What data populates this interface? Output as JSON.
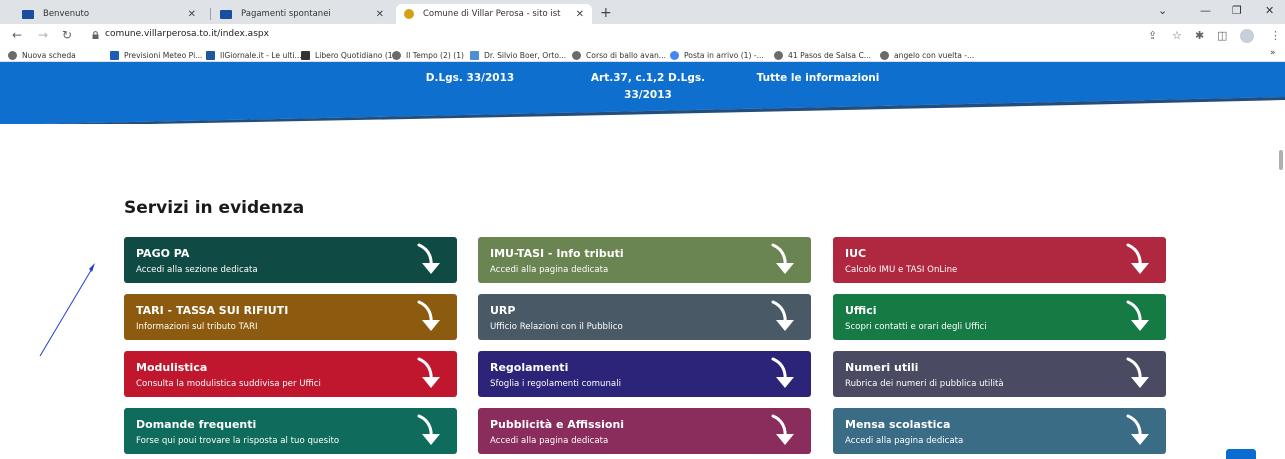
{
  "browser": {
    "tabs": [
      {
        "label": "Benvenuto",
        "active": false
      },
      {
        "label": "Pagamenti spontanei",
        "active": false
      },
      {
        "label": "Comune di Villar Perosa - sito ist",
        "active": true
      }
    ],
    "url": "comune.villarperosa.to.it/index.aspx",
    "bookmarks": [
      "Nuova scheda",
      "Previsioni Meteo Pi...",
      "IlGiornale.it - Le ulti...",
      "Libero Quotidiano (1)",
      "Il Tempo (2) (1)",
      "Dr. Silvio Boer, Orto...",
      "Corso di ballo avan...",
      "Posta in arrivo (1) -...",
      "41 Pasos de Salsa C...",
      "angelo con vuelta -..."
    ],
    "more_bookmarks": "»"
  },
  "banner": {
    "col1": "D.Lgs. 33/2013",
    "col2_line1": "Art.37, c.1,2 D.Lgs.",
    "col2_line2": "33/2013",
    "col3": "Tutte le informazioni",
    "color": "#0f6fcf"
  },
  "section": {
    "title": "Servizi in evidenza"
  },
  "cards": [
    {
      "title": "PAGO PA",
      "subtitle": "Accedi alla sezione dedicata",
      "color": "#0f4a45"
    },
    {
      "title": "IMU-TASI - Info tributi",
      "subtitle": "Accedi alla pagina dedicata",
      "color": "#6a8452"
    },
    {
      "title": "IUC",
      "subtitle": "Calcolo IMU e TASI OnLine",
      "color": "#b02840"
    },
    {
      "title": "TARI - TASSA SUI RIFIUTI",
      "subtitle": "Informazioni sul tributo TARI",
      "color": "#8c5b0f"
    },
    {
      "title": "URP",
      "subtitle": "Ufficio Relazioni con il Pubblico",
      "color": "#4a5966"
    },
    {
      "title": "Uffici",
      "subtitle": "Scopri contatti e orari degli Uffici",
      "color": "#167a45"
    },
    {
      "title": "Modulistica",
      "subtitle": "Consulta la modulistica suddivisa per Uffici",
      "color": "#c0162e"
    },
    {
      "title": "Regolamenti",
      "subtitle": "Sfoglia i regolamenti comunali",
      "color": "#2c2479"
    },
    {
      "title": "Numeri utili",
      "subtitle": "Rubrica dei numeri di pubblica utilità",
      "color": "#4a4a62"
    },
    {
      "title": "Domande frequenti",
      "subtitle": "Forse qui poui trovare la risposta al tuo quesito",
      "color": "#0f6b5c"
    },
    {
      "title": "Pubblicità e Affissioni",
      "subtitle": "Accedi alla pagina dedicata",
      "color": "#8a2c5c"
    },
    {
      "title": "Mensa scolastica",
      "subtitle": "Accedi alla pagina dedicata",
      "color": "#3a6c86"
    }
  ]
}
